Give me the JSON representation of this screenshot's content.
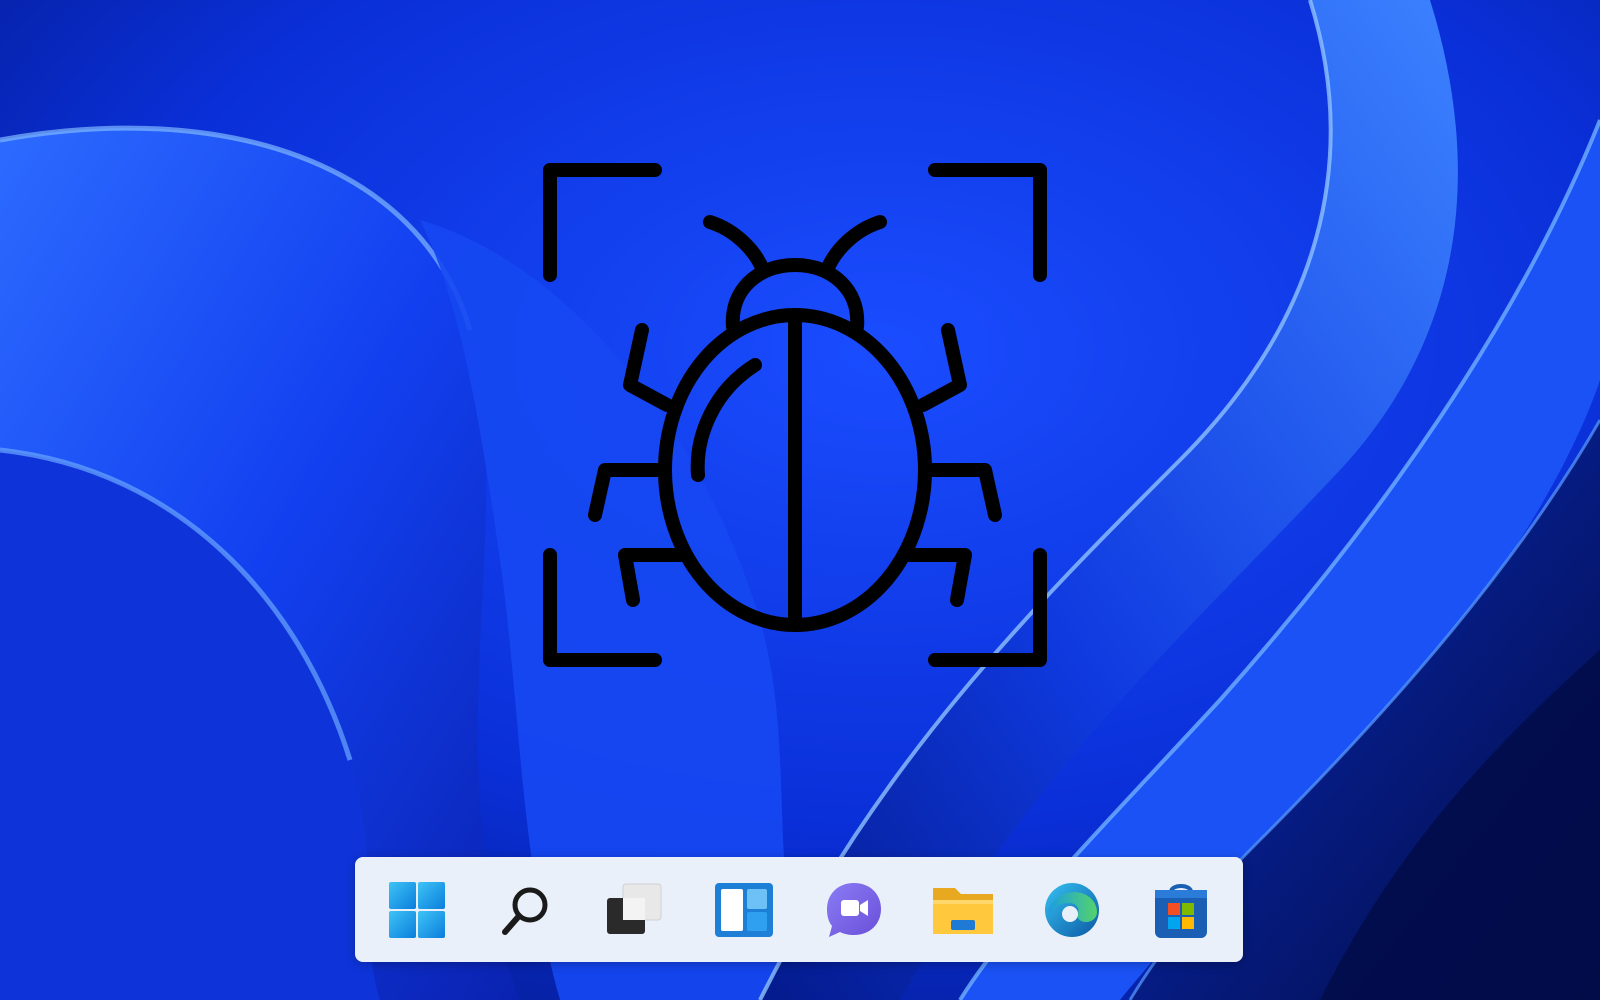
{
  "desktop": {
    "wallpaper": "windows-11-bloom-blue",
    "colors": {
      "wallpaper_base": "#0b2fd6",
      "wallpaper_highlight": "#4f9dff",
      "wallpaper_shadow": "#02104f",
      "bug_icon_stroke": "#000000",
      "taskbar_bg": "#eaf0fa"
    }
  },
  "center_icon": {
    "name": "bug-scan-icon"
  },
  "taskbar": {
    "items": [
      {
        "id": "start",
        "icon": "windows-logo-icon"
      },
      {
        "id": "search",
        "icon": "search-icon"
      },
      {
        "id": "task-view",
        "icon": "task-view-icon"
      },
      {
        "id": "widgets",
        "icon": "widgets-icon"
      },
      {
        "id": "teams-chat",
        "icon": "teams-chat-icon"
      },
      {
        "id": "file-explorer",
        "icon": "file-explorer-icon"
      },
      {
        "id": "edge",
        "icon": "edge-icon"
      },
      {
        "id": "store",
        "icon": "microsoft-store-icon"
      }
    ]
  }
}
